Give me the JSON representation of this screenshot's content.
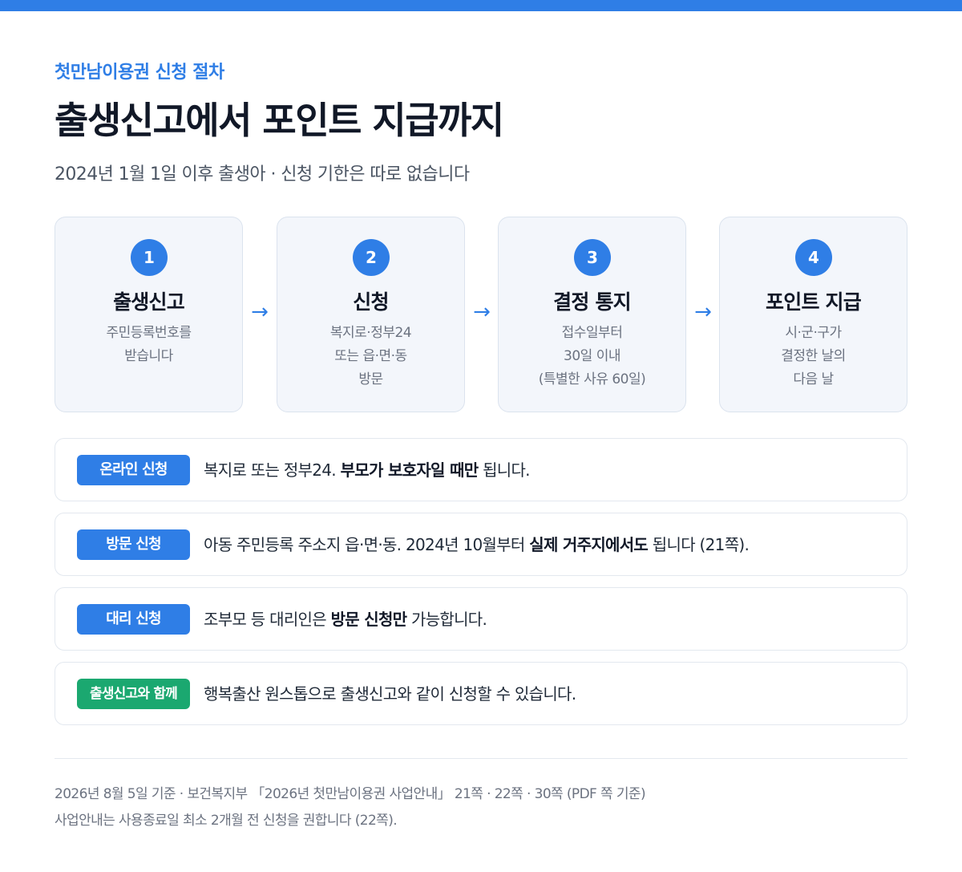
{
  "header": {
    "eyebrow": "첫만남이용권 신청 절차",
    "title": "출생신고에서 포인트 지급까지",
    "subtitle": "2024년 1월 1일 이후 출생아 · 신청 기한은 따로 없습니다"
  },
  "steps": [
    {
      "num": "1",
      "title": "출생신고",
      "lines": [
        "주민등록번호를",
        "받습니다"
      ]
    },
    {
      "num": "2",
      "title": "신청",
      "lines": [
        "복지로·정부24",
        "또는 읍·면·동",
        "방문"
      ]
    },
    {
      "num": "3",
      "title": "결정 통지",
      "lines": [
        "접수일부터",
        "30일 이내",
        "(특별한 사유 60일)"
      ]
    },
    {
      "num": "4",
      "title": "포인트 지급",
      "lines": [
        "시·군·구가",
        "결정한 날의",
        "다음 날"
      ]
    }
  ],
  "arrow_glyph": "→",
  "notes": [
    {
      "badge": "온라인 신청",
      "pre": "복지로 또는 정부24. ",
      "bold": "부모가 보호자일 때만",
      "post": " 됩니다."
    },
    {
      "badge": "방문 신청",
      "pre": "아동 주민등록 주소지 읍·면·동. 2024년 10월부터 ",
      "bold": "실제 거주지에서도",
      "post": " 됩니다 (21쪽)."
    },
    {
      "badge": "대리 신청",
      "pre": "조부모 등 대리인은 ",
      "bold": "방문 신청만",
      "post": " 가능합니다."
    },
    {
      "badge": "출생신고와 함께",
      "pre": "행복출산 원스톱으로 출생신고와 같이 신청할 수 있습니다.",
      "bold": "",
      "post": ""
    }
  ],
  "footer": {
    "line1": "2026년 8월 5일 기준 · 보건복지부 「2026년 첫만남이용권 사업안내」 21쪽 · 22쪽 · 30쪽 (PDF 쪽 기준)",
    "line2": "사업안내는 사용종료일 최소 2개월 전 신청을 권합니다 (22쪽)."
  },
  "colors": {
    "accent": "#2f7ee6",
    "green_badge": "#1ba870",
    "card_bg": "#f3f6fb"
  }
}
